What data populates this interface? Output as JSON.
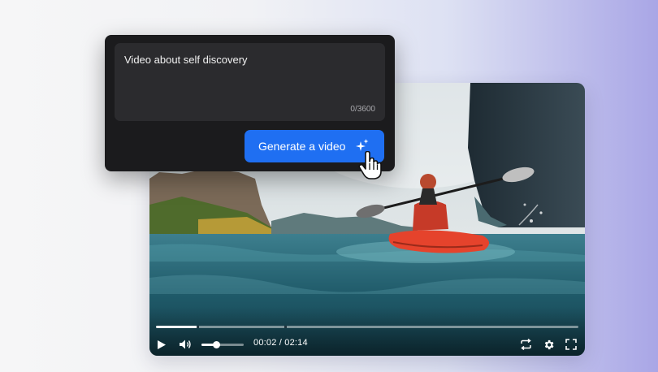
{
  "prompt": {
    "text": "Video about self discovery",
    "char_count": "0/3600"
  },
  "generate_button": {
    "label": "Generate a video",
    "icon": "sparkle-icon"
  },
  "player": {
    "current_time": "00:02",
    "duration": "02:14",
    "time_display": "00:02 / 02:14",
    "progress_fraction": 0.1,
    "volume_fraction": 0.35,
    "controls": [
      "play-icon",
      "volume-icon",
      "loop-icon",
      "settings-icon",
      "fullscreen-icon"
    ]
  },
  "colors": {
    "accent": "#1f6ff2",
    "panel_bg": "#1b1b1d",
    "input_bg": "#2b2b2e"
  }
}
